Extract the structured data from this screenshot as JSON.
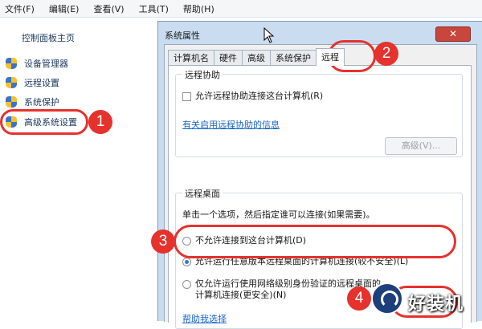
{
  "menubar": {
    "items": [
      "文件(F)",
      "编辑(E)",
      "查看(V)",
      "工具(T)",
      "帮助(H)"
    ]
  },
  "sidebar": {
    "home": "控制面板主页",
    "items": [
      {
        "label": "设备管理器",
        "icon": "shield-icon"
      },
      {
        "label": "远程设置",
        "icon": "shield-icon"
      },
      {
        "label": "系统保护",
        "icon": "shield-icon"
      },
      {
        "label": "高级系统设置",
        "icon": "shield-icon"
      }
    ]
  },
  "window": {
    "title": "系统属性",
    "close": "✕",
    "tabs": [
      "计算机名",
      "硬件",
      "高级",
      "系统保护",
      "远程"
    ],
    "active_tab": "远程"
  },
  "remote_assist": {
    "title": "远程协助",
    "checkbox_label": "允许远程协助连接这台计算机(R)",
    "checked": false,
    "link": "有关启用远程协助的信息",
    "advanced_button": "高级(V)..."
  },
  "remote_desktop": {
    "title": "远程桌面",
    "instruction": "单击一个选项，然后指定谁可以连接(如果需要)。",
    "options": [
      {
        "label": "不允许连接到这台计算机(D)",
        "checked": false
      },
      {
        "label": "允许运行任意版本远程桌面的计算机连接(较不安全)(L)",
        "checked": true
      },
      {
        "label": "仅允许运行使用网络级别身份验证的远程桌面的计算机连接(更安全)(N)",
        "checked": false
      }
    ],
    "help_link": "帮助我选择"
  },
  "annotations": {
    "steps": [
      "1",
      "2",
      "3",
      "4"
    ],
    "color": "#e5322d"
  },
  "watermark": {
    "text": "好装机"
  }
}
